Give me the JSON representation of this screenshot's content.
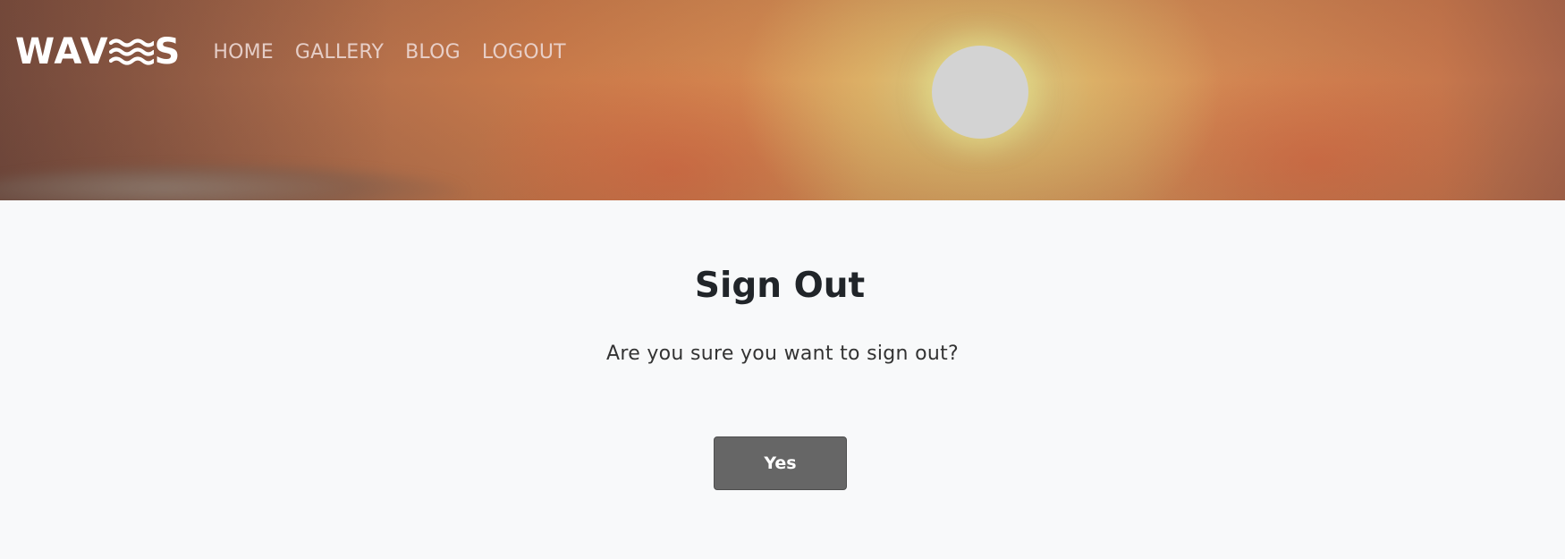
{
  "brand": {
    "text_before": "WAV",
    "icon": "waves-icon",
    "text_after": "S"
  },
  "nav": {
    "items": [
      {
        "label": "HOME"
      },
      {
        "label": "GALLERY"
      },
      {
        "label": "BLOG"
      },
      {
        "label": "LOGOUT"
      }
    ]
  },
  "page": {
    "title": "Sign Out",
    "prompt": "Are you sure you want to sign out?",
    "confirm_label": "Yes"
  },
  "colors": {
    "background": "#f8f9fa",
    "button": "#666666",
    "heading": "#212529",
    "sun": "#d3d3d3"
  }
}
